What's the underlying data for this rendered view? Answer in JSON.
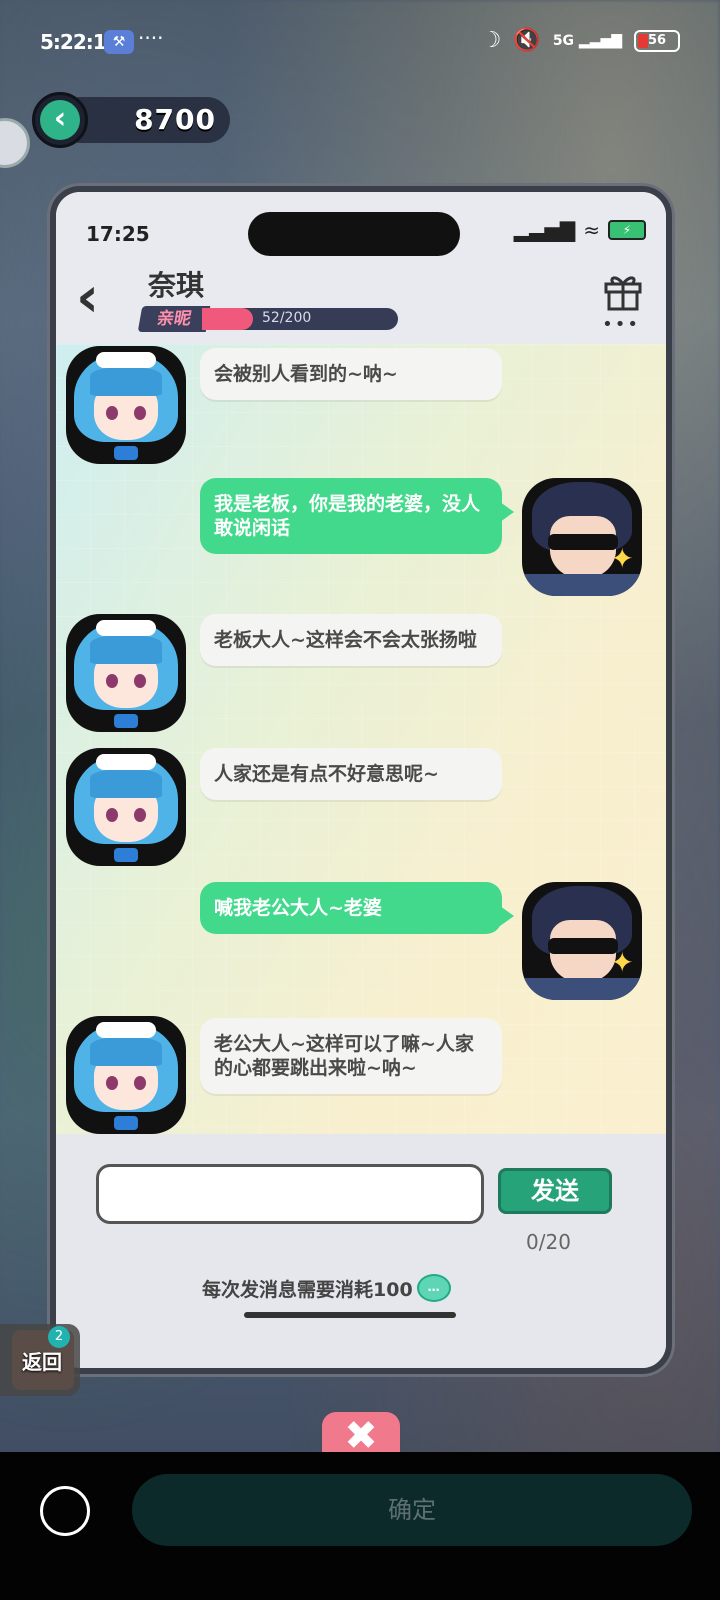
{
  "status_bar": {
    "time": "5:22:14",
    "dots": "····",
    "battery": "56",
    "network": "5G"
  },
  "game": {
    "coins": "8700"
  },
  "chat_header": {
    "time": "17:25",
    "name": "奈琪",
    "intimacy_label": "亲昵",
    "intimacy_value": "52/200",
    "intimacy_fraction": 0.26
  },
  "messages": [
    {
      "sender": "npc",
      "text": "会被别人看到的~呐~"
    },
    {
      "sender": "player",
      "text": "我是老板，你是我的老婆，没人敢说闲话"
    },
    {
      "sender": "npc",
      "text": "老板大人~这样会不会太张扬啦"
    },
    {
      "sender": "npc",
      "text": "人家还是有点不好意思呢~"
    },
    {
      "sender": "player",
      "text": "喊我老公大人~老婆"
    },
    {
      "sender": "npc",
      "text": "老公大人~这样可以了嘛~人家的心都要跳出来啦~呐~"
    }
  ],
  "composer": {
    "input_value": "",
    "send_label": "发送",
    "counter": "0/20",
    "cost_note": "每次发消息需要消耗100"
  },
  "overlay": {
    "return_label": "返回",
    "return_badge": "2"
  },
  "bottom_bar": {
    "confirm_label": "确定"
  },
  "colors": {
    "player_bubble": "#43d98c",
    "npc_bubble": "#f4f4f2",
    "send_button": "#27a37a",
    "intimacy_fill": "#f0587c"
  },
  "icons": [
    "back-arrow-icon",
    "gift-icon",
    "more-icon",
    "wifi-icon",
    "signal-icon",
    "battery-icon",
    "moon-icon",
    "mute-icon",
    "close-icon",
    "coin-icon"
  ]
}
